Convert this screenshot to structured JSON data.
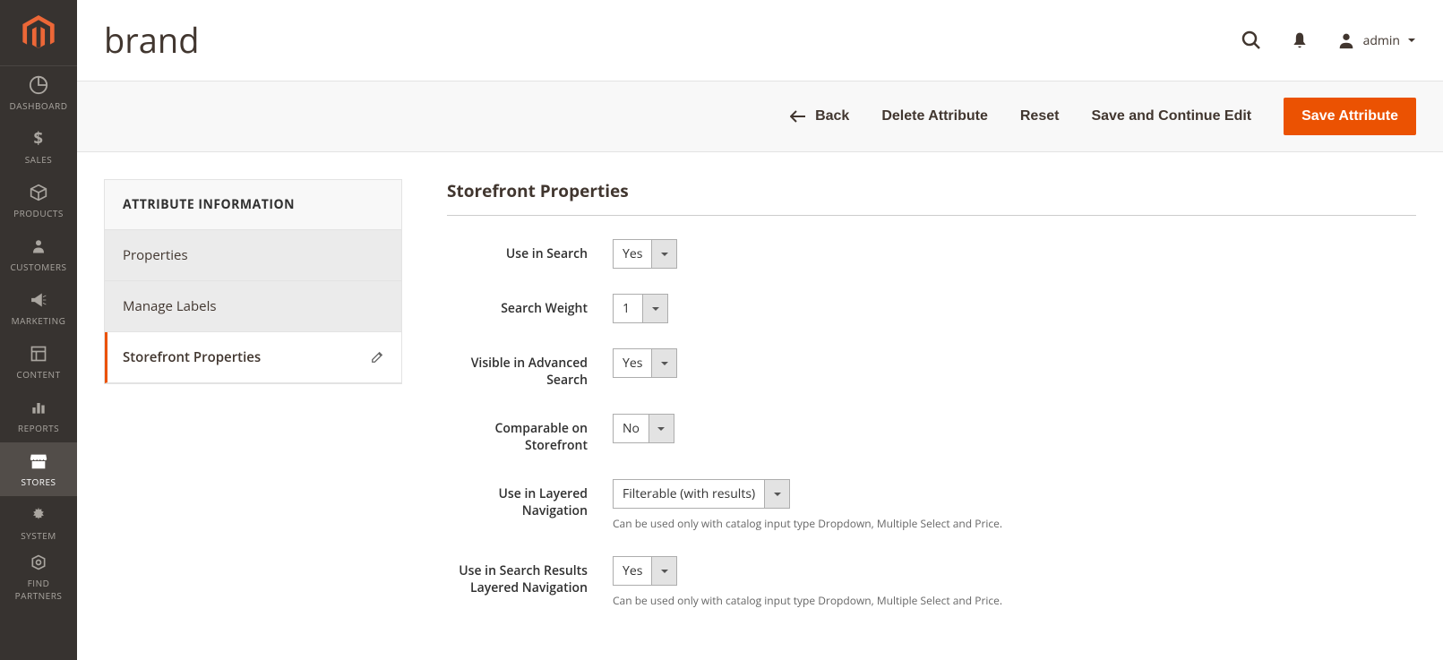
{
  "header": {
    "page_title": "brand",
    "user_label": "admin"
  },
  "nav": {
    "items": [
      {
        "label": "DASHBOARD",
        "icon": "dashboard"
      },
      {
        "label": "SALES",
        "icon": "dollar"
      },
      {
        "label": "PRODUCTS",
        "icon": "box"
      },
      {
        "label": "CUSTOMERS",
        "icon": "person"
      },
      {
        "label": "MARKETING",
        "icon": "megaphone"
      },
      {
        "label": "CONTENT",
        "icon": "layout"
      },
      {
        "label": "REPORTS",
        "icon": "bars"
      },
      {
        "label": "STORES",
        "icon": "storefront",
        "active": true
      },
      {
        "label": "SYSTEM",
        "icon": "gear"
      },
      {
        "label": "FIND PARTNERS",
        "icon": "partners"
      }
    ]
  },
  "toolbar": {
    "back": "Back",
    "delete": "Delete Attribute",
    "reset": "Reset",
    "save_continue": "Save and Continue Edit",
    "save": "Save Attribute"
  },
  "side_panel": {
    "heading": "ATTRIBUTE INFORMATION",
    "tabs": [
      {
        "label": "Properties"
      },
      {
        "label": "Manage Labels"
      },
      {
        "label": "Storefront Properties",
        "active": true
      }
    ]
  },
  "form": {
    "section_title": "Storefront Properties",
    "fields": {
      "use_in_search": {
        "label": "Use in Search",
        "value": "Yes"
      },
      "search_weight": {
        "label": "Search Weight",
        "value": "1"
      },
      "visible_advanced": {
        "label": "Visible in Advanced Search",
        "value": "Yes"
      },
      "comparable": {
        "label": "Comparable on Storefront",
        "value": "No"
      },
      "layered_nav": {
        "label": "Use in Layered Navigation",
        "value": "Filterable (with results)",
        "note": "Can be used only with catalog input type Dropdown, Multiple Select and Price."
      },
      "search_layered": {
        "label": "Use in Search Results Layered Navigation",
        "value": "Yes",
        "note": "Can be used only with catalog input type Dropdown, Multiple Select and Price."
      }
    }
  }
}
